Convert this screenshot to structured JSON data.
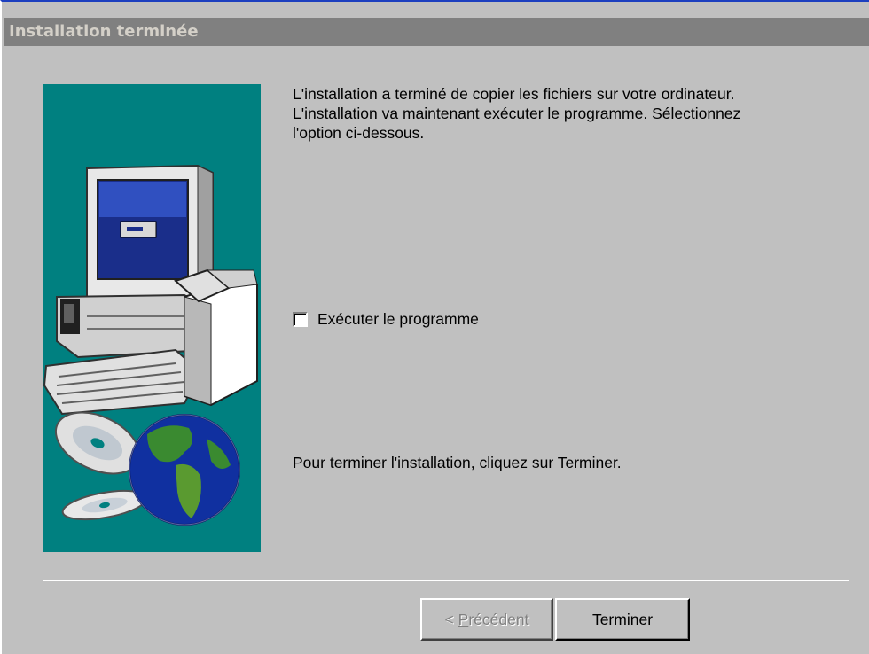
{
  "window": {
    "title": "Installation terminée"
  },
  "main": {
    "intro_lines": [
      "L'installation a terminé de copier les fichiers sur votre ordinateur.",
      "L'installation va maintenant exécuter le programme. Sélectionnez",
      "l'option ci-dessous."
    ],
    "checkbox": {
      "label": "Exécuter le programme",
      "checked": false
    },
    "finish_text": "Pour terminer l'installation, cliquez sur Terminer."
  },
  "buttons": {
    "back": {
      "prefix": "< ",
      "accel": "P",
      "rest": "récédent",
      "enabled": false
    },
    "finish": {
      "label": "Terminer",
      "enabled": true
    }
  },
  "illustration": {
    "icons": [
      "computer-icon",
      "software-box-icon",
      "cd-disc-icon",
      "globe-icon"
    ],
    "background_color": "#008080"
  }
}
